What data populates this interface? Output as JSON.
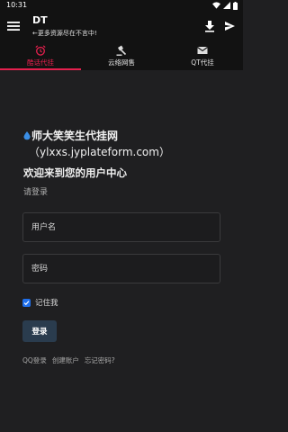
{
  "status_bar": {
    "time": "10:31",
    "icons": [
      "wifi-icon",
      "signal-icon",
      "battery-icon"
    ]
  },
  "app_bar": {
    "title": "DT",
    "subtitle": "←更多资源尽在不言中!",
    "icons": [
      "menu-icon",
      "download-icon",
      "share-icon"
    ]
  },
  "tabs": [
    {
      "label": "酷话代挂",
      "icon": "alarm-icon",
      "active": true
    },
    {
      "label": "云络网售",
      "icon": "gavel-icon",
      "active": false
    },
    {
      "label": "QT代挂",
      "icon": "mail-icon",
      "active": false
    }
  ],
  "brand": {
    "name": "师大笑笑生代挂网",
    "domain": "（ylxxs.jyplateform.com）"
  },
  "login": {
    "welcome": "欢迎来到您的用户中心",
    "hint": "请登录",
    "username_placeholder": "用户名",
    "password_placeholder": "密码",
    "remember_label": "记住我",
    "remember_checked": true,
    "submit_label": "登录"
  },
  "links": {
    "qq_login": "QQ登录",
    "create_account": "创建账户",
    "forgot_password": "忘记密码?"
  },
  "colors": {
    "accent": "#e5204e",
    "bar": "#121212",
    "background": "#1f1f21",
    "button": "#2a3c4e",
    "checkbox": "#1f6feb"
  }
}
